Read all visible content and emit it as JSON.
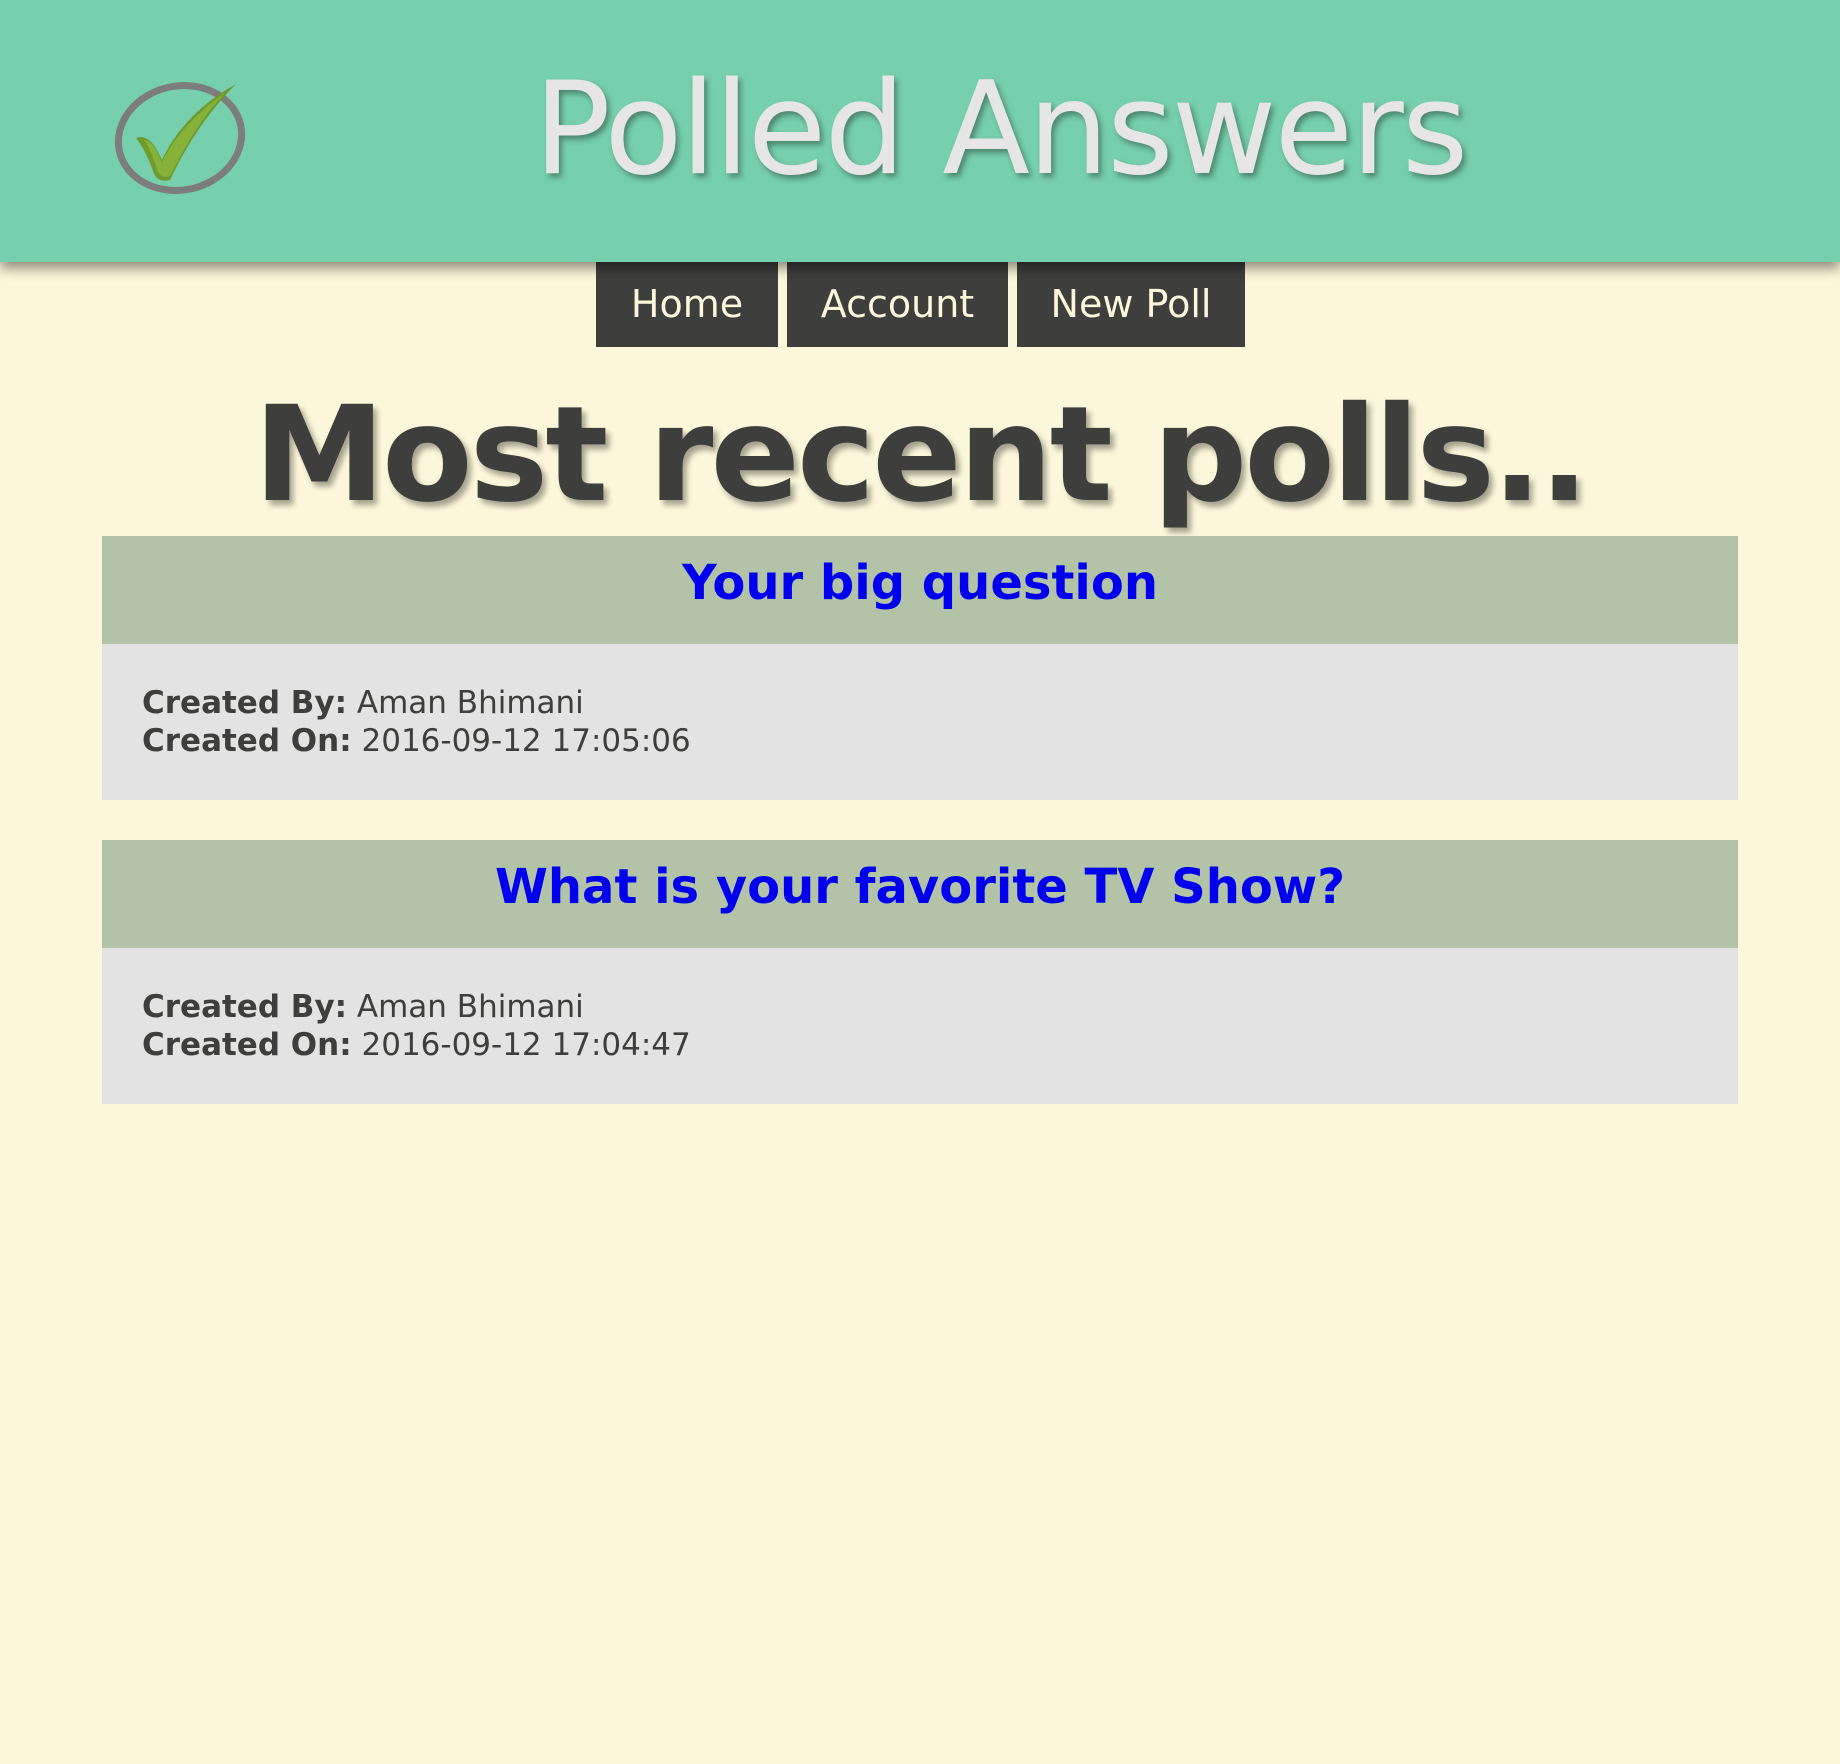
{
  "header": {
    "title": "Polled Answers",
    "logo": "checkmark-circle-icon"
  },
  "nav": {
    "items": [
      {
        "label": "Home"
      },
      {
        "label": "Account"
      },
      {
        "label": "New Poll"
      }
    ]
  },
  "main": {
    "heading": "Most recent polls..",
    "polls": [
      {
        "title": "Your big question",
        "created_by_label": "Created By:",
        "created_by": "Aman Bhimani",
        "created_on_label": "Created On:",
        "created_on": "2016-09-12 17:05:06"
      },
      {
        "title": "What is your favorite TV Show?",
        "created_by_label": "Created By:",
        "created_by": "Aman Bhimani",
        "created_on_label": "Created On:",
        "created_on": "2016-09-12 17:04:47"
      }
    ]
  },
  "colors": {
    "header_bg": "#76cfad",
    "page_bg": "#fcf7da",
    "nav_bg": "#3e3e3c",
    "card_header_bg": "#b2c3a8",
    "card_body_bg": "#e3e3e3",
    "link": "#0000ee"
  }
}
